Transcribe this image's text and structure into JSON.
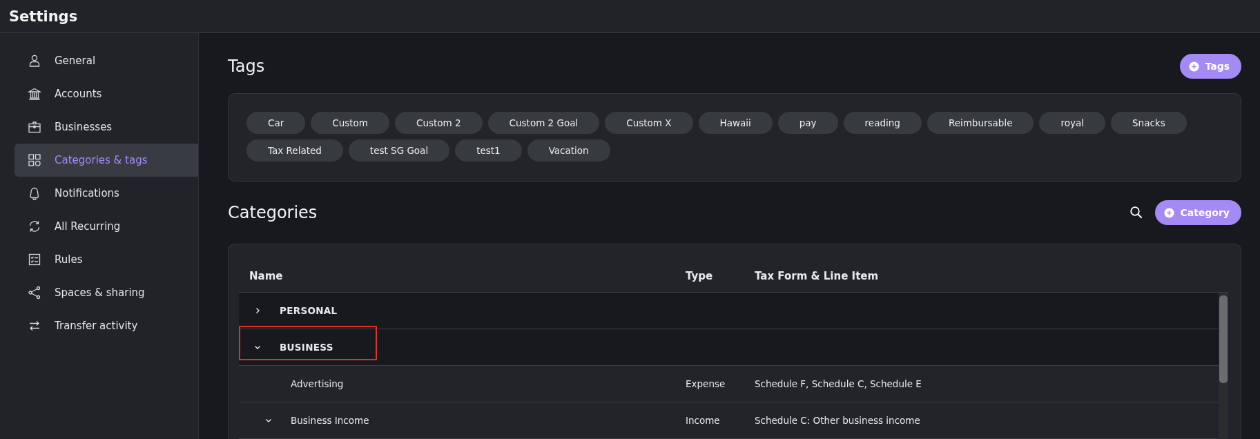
{
  "window": {
    "title": "Settings"
  },
  "sidebar": {
    "items": [
      {
        "label": "General",
        "selected": false
      },
      {
        "label": "Accounts",
        "selected": false
      },
      {
        "label": "Businesses",
        "selected": false
      },
      {
        "label": "Categories & tags",
        "selected": true
      },
      {
        "label": "Notifications",
        "selected": false
      },
      {
        "label": "All Recurring",
        "selected": false
      },
      {
        "label": "Rules",
        "selected": false
      },
      {
        "label": "Spaces & sharing",
        "selected": false
      },
      {
        "label": "Transfer activity",
        "selected": false
      }
    ]
  },
  "tags": {
    "title": "Tags",
    "add_button": "Tags",
    "items": [
      "Car",
      "Custom",
      "Custom 2",
      "Custom 2 Goal",
      "Custom X",
      "Hawaii",
      "pay",
      "reading",
      "Reimbursable",
      "royal",
      "Snacks",
      "Tax Related",
      "test SG Goal",
      "test1",
      "Vacation"
    ]
  },
  "categories": {
    "title": "Categories",
    "add_button": "Category",
    "columns": [
      "Name",
      "Type",
      "Tax Form & Line Item"
    ],
    "rows": [
      {
        "kind": "group",
        "name": "PERSONAL",
        "expanded": false,
        "highlighted": false
      },
      {
        "kind": "group",
        "name": "BUSINESS",
        "expanded": true,
        "highlighted": true,
        "children": [
          {
            "kind": "category",
            "name": "Advertising",
            "type": "Expense",
            "tax_form": "Schedule F, Schedule C, Schedule E"
          },
          {
            "kind": "category",
            "name": "Business Income",
            "type": "Income",
            "tax_form": "Schedule C: Other business income",
            "expanded": true
          }
        ]
      }
    ]
  }
}
